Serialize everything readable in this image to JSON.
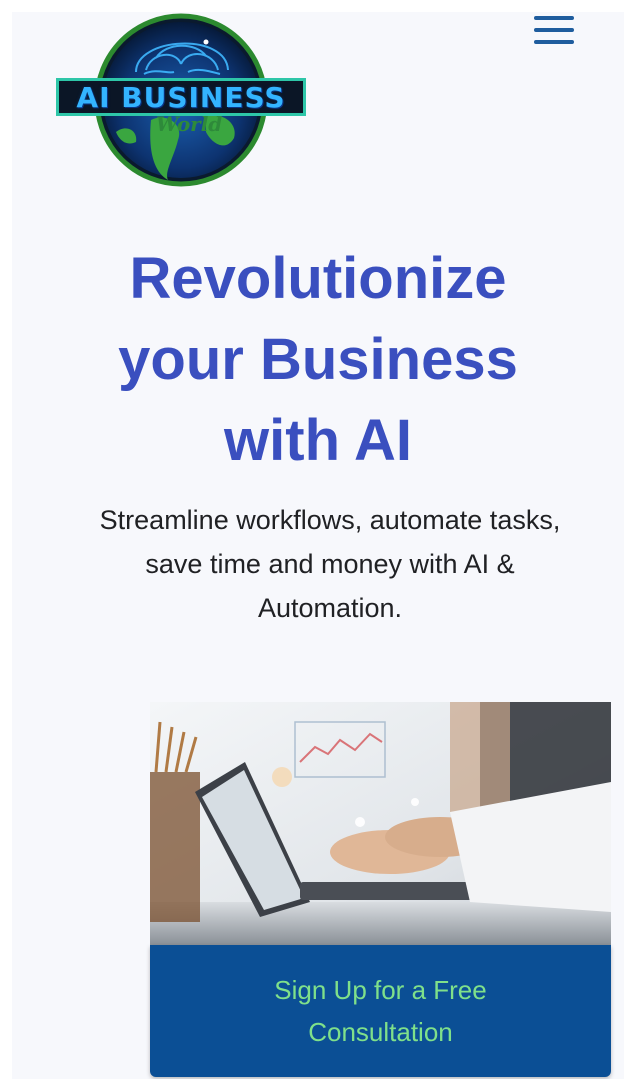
{
  "logo": {
    "brand_text": "AI BUSINESS",
    "script_text": "World"
  },
  "header": {
    "menu_icon": "hamburger-menu-icon"
  },
  "hero": {
    "title_lines": [
      "Revolutionize",
      "your Business",
      "with AI"
    ],
    "subtitle_lines": [
      "Streamline workflows, automate tasks,",
      "save time and money with AI &",
      "Automation."
    ]
  },
  "cta": {
    "label": "Sign Up for a Free Consultation"
  },
  "colors": {
    "title": "#3a4fbf",
    "cta_background": "#0b4f95",
    "cta_text": "#7fe08a",
    "menu_icon": "#1f5d9e"
  }
}
